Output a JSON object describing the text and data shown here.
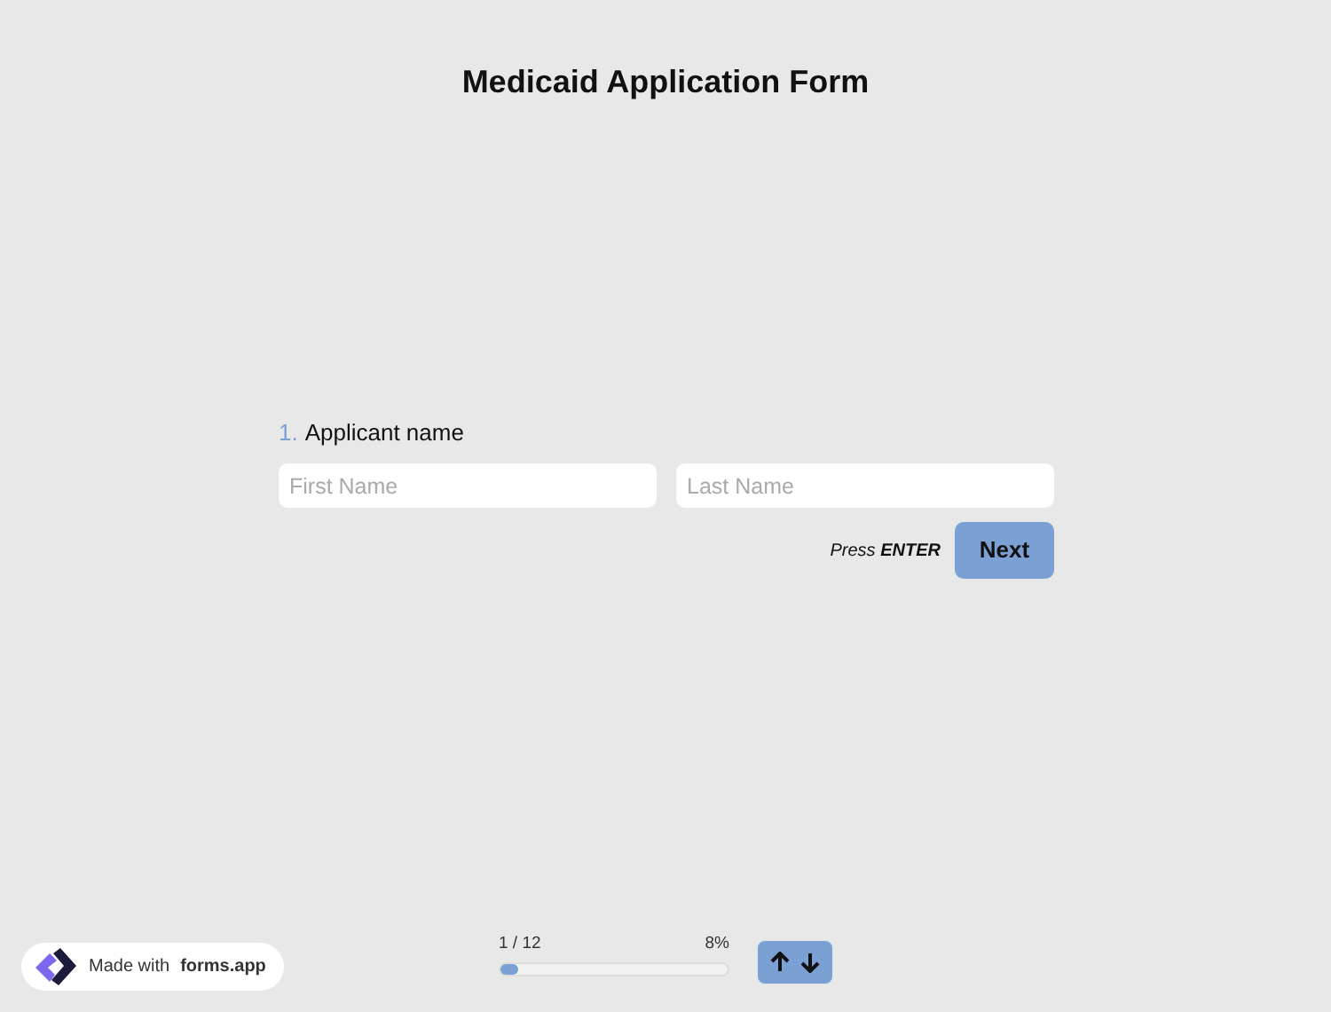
{
  "title": "Medicaid Application Form",
  "question": {
    "number": "1.",
    "label": "Applicant name",
    "fields": [
      {
        "placeholder": "First Name"
      },
      {
        "placeholder": "Last Name"
      }
    ]
  },
  "hint": "Press **ENTER**",
  "next_button": "Next",
  "progress": {
    "count": "1 / 12",
    "percent": "8%",
    "level": 0.08
  },
  "branding": {
    "prefix": "Made with",
    "brand": "forms.app"
  }
}
